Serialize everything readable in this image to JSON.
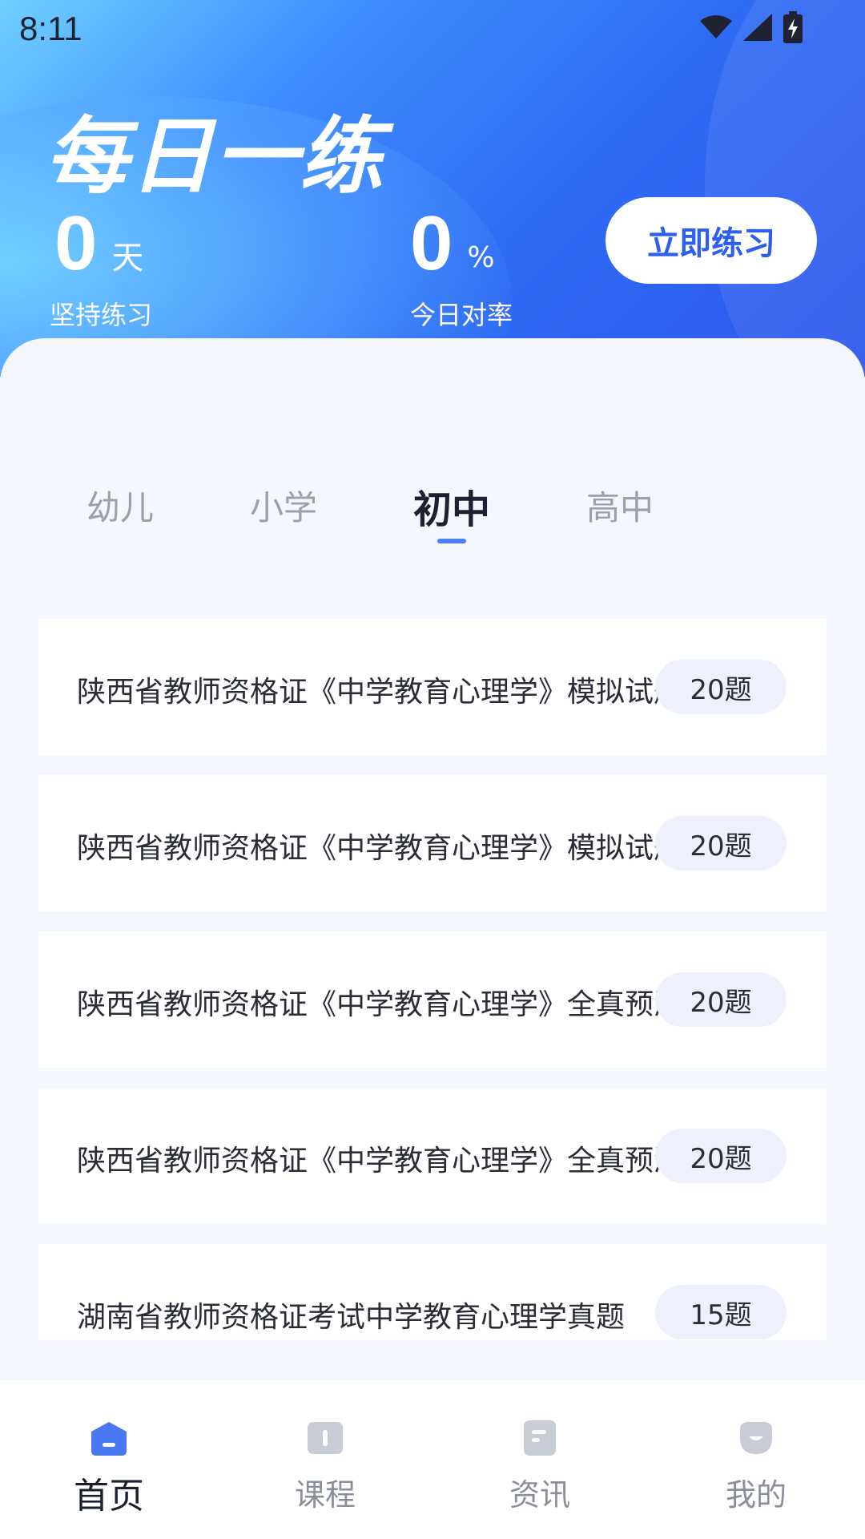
{
  "status_bar": {
    "time": "8:11"
  },
  "header": {
    "title": "每日一练",
    "days": {
      "value": "0",
      "unit": "天",
      "label": "坚持练习"
    },
    "rate": {
      "value": "0",
      "unit": "%",
      "label": "今日对率"
    },
    "practice_button": "立即练习"
  },
  "tabs": [
    {
      "label": "幼儿",
      "active": false
    },
    {
      "label": "小学",
      "active": false
    },
    {
      "label": "初中",
      "active": true
    },
    {
      "label": "高中",
      "active": false
    }
  ],
  "items": [
    {
      "title": "陕西省教师资格证《中学教育心理学》模拟试题",
      "count": "20题"
    },
    {
      "title": "陕西省教师资格证《中学教育心理学》模拟试题",
      "count": "20题"
    },
    {
      "title": "陕西省教师资格证《中学教育心理学》全真预测",
      "count": "20题"
    },
    {
      "title": "陕西省教师资格证《中学教育心理学》全真预测",
      "count": "20题"
    },
    {
      "title": "湖南省教师资格证考试中学教育心理学真题",
      "count": "15题"
    }
  ],
  "bottom_nav": [
    {
      "label": "首页",
      "icon": "home-icon",
      "active": true
    },
    {
      "label": "课程",
      "icon": "book-icon",
      "active": false
    },
    {
      "label": "资讯",
      "icon": "news-icon",
      "active": false
    },
    {
      "label": "我的",
      "icon": "profile-icon",
      "active": false
    }
  ],
  "colors": {
    "accent": "#2c5ff0",
    "header_gradient_start": "#6fd0ff",
    "header_gradient_end": "#2b55ec",
    "badge_bg": "#eef1fd",
    "nav_icon_active": "#4a78f5",
    "nav_icon_inactive": "#c7ccd6"
  }
}
